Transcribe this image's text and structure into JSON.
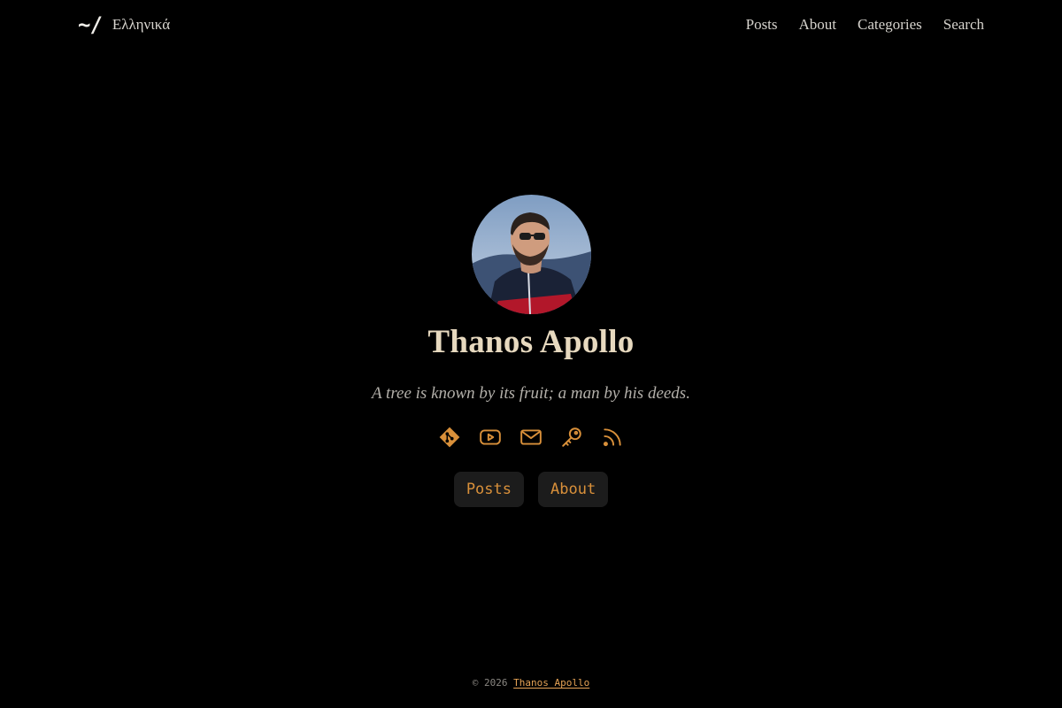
{
  "header": {
    "logo": "~/",
    "lang_switch": "Ελληνικά",
    "nav": [
      "Posts",
      "About",
      "Categories",
      "Search"
    ]
  },
  "profile": {
    "name": "Thanos Apollo",
    "tagline": "A tree is known by its fruit; a man by his deeds."
  },
  "social_icons": [
    "git-icon",
    "youtube-icon",
    "mail-icon",
    "key-icon",
    "rss-icon"
  ],
  "buttons": [
    "Posts",
    "About"
  ],
  "footer": {
    "copyright": "© 2026",
    "author_link": "Thanos Apollo"
  },
  "colors": {
    "background": "#000000",
    "accent": "#d9903a",
    "name": "#e7d9bf",
    "button_bg": "#1c1c1c"
  }
}
